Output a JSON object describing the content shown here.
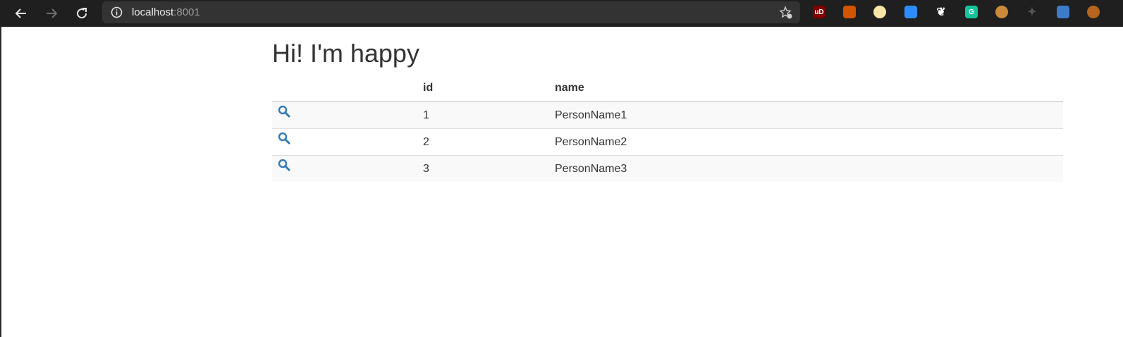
{
  "browser": {
    "url_host": "localhost",
    "url_port": ":8001",
    "extensions": [
      {
        "name": "ublock-icon",
        "color": "#800000",
        "text": "uD"
      },
      {
        "name": "bug-icon",
        "color": "#d35400",
        "text": ""
      },
      {
        "name": "notes-icon",
        "color": "#f5e6a8",
        "text": ""
      },
      {
        "name": "zoom-icon",
        "color": "#2d8cff",
        "text": ""
      },
      {
        "name": "gnome-icon",
        "color": "#ffffff",
        "text": ""
      },
      {
        "name": "grammarly-icon",
        "color": "#15c39a",
        "text": "G"
      },
      {
        "name": "cookie-icon",
        "color": "#c98a3c",
        "text": ""
      },
      {
        "name": "puzzle-icon",
        "color": "#555555",
        "text": ""
      },
      {
        "name": "dropbox-icon",
        "color": "#3d7cc9",
        "text": ""
      },
      {
        "name": "avatar-icon",
        "color": "#b5651d",
        "text": ""
      }
    ]
  },
  "page": {
    "heading": "Hi! I'm happy"
  },
  "table": {
    "columns": [
      "",
      "id",
      "name"
    ],
    "rows": [
      {
        "id": "1",
        "name": "PersonName1"
      },
      {
        "id": "2",
        "name": "PersonName2"
      },
      {
        "id": "3",
        "name": "PersonName3"
      }
    ]
  },
  "colors": {
    "link_blue": "#337ab7",
    "text": "#333333",
    "stripe": "#f9f9f9"
  }
}
